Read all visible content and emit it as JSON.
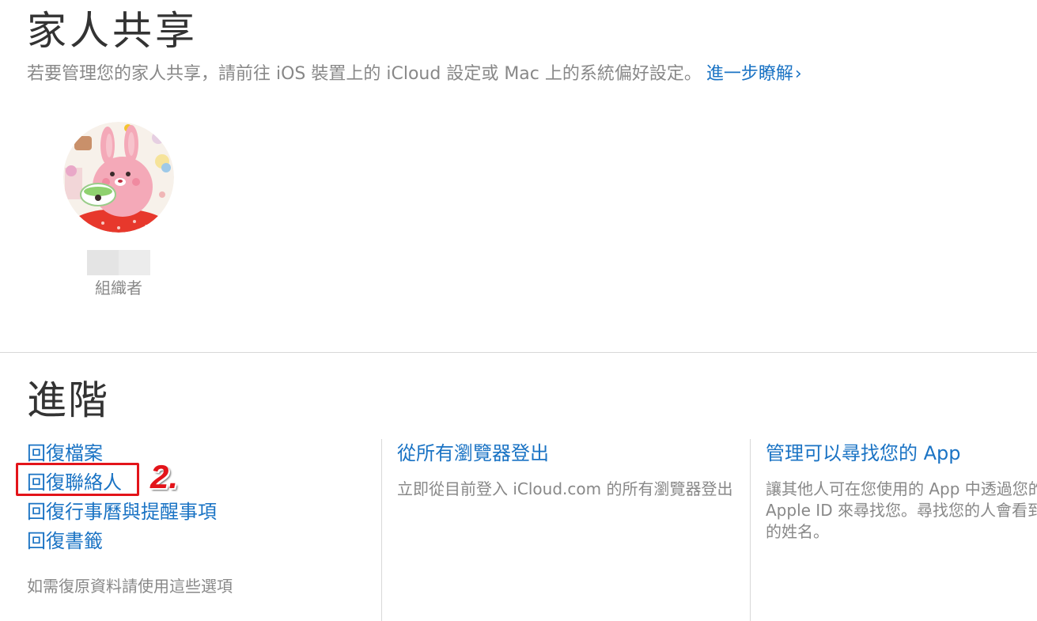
{
  "family": {
    "title": "家人共享",
    "subtitle": "若要管理您的家人共享，請前往 iOS 裝置上的 iCloud 設定或 Mac 上的系統偏好設定。",
    "learn_more": "進一步瞭解",
    "chevron": "›"
  },
  "member": {
    "role": "組織者",
    "avatar_icon": "avatar-image"
  },
  "advanced": {
    "title": "進階",
    "restore": {
      "links": [
        "回復檔案",
        "回復聯絡人",
        "回復行事曆與提醒事項",
        "回復書籤"
      ],
      "hint": "如需復原資料請使用這些選項",
      "highlight_label": "2."
    },
    "sign_out": {
      "title": "從所有瀏覽器登出",
      "description": "立即從目前登入 iCloud.com 的所有瀏覽器登出"
    },
    "find_me": {
      "title": "管理可以尋找您的 App",
      "description": "讓其他人可在您使用的 App 中透過您的 Apple ID 來尋找您。尋找您的人會看到您的姓名。"
    }
  },
  "colors": {
    "link": "#1a73c4",
    "highlight": "#e3141a",
    "muted_text": "#888888"
  }
}
